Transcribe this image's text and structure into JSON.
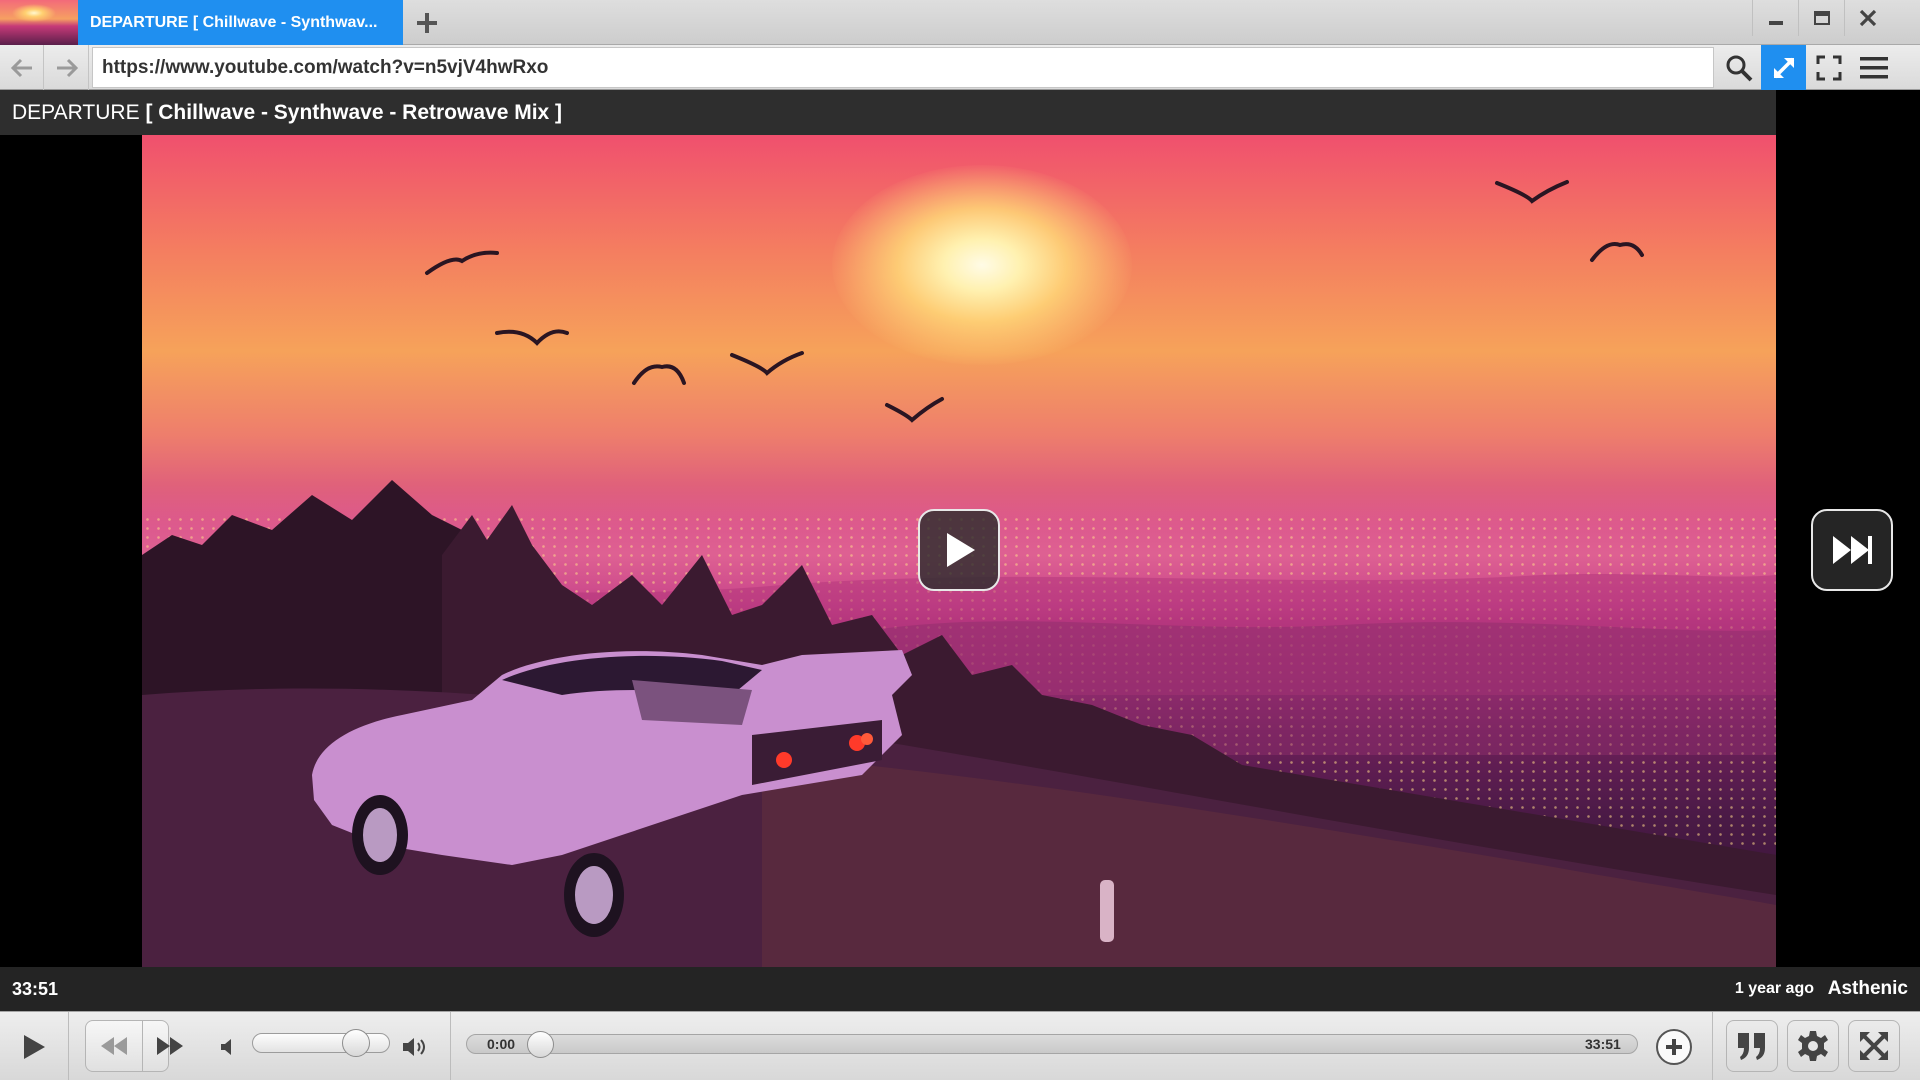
{
  "browser": {
    "tab_title": "DEPARTURE [ Chillwave - Synthwav...",
    "url": "https://www.youtube.com/watch?v=n5vjV4hwRxo",
    "accent_color": "#1f8ff0"
  },
  "video": {
    "title_plain": "DEPARTURE",
    "title_bold": "[ Chillwave - Synthwave - Retrowave Mix ]",
    "duration_label": "33:51",
    "uploaded": "1 year ago",
    "channel": "Asthenic"
  },
  "player": {
    "current_time": "0:00",
    "total_time": "33:51",
    "volume_level": 0.8,
    "progress": 0.0
  },
  "icons": [
    "back-icon",
    "forward-icon",
    "search-icon",
    "resize-icon",
    "fullscreen-icon",
    "menu-icon",
    "play-icon",
    "next-icon",
    "rewind-icon",
    "fast-forward-icon",
    "mute-icon",
    "volume-icon",
    "add-icon",
    "quote-icon",
    "gear-icon",
    "expand-icon"
  ]
}
